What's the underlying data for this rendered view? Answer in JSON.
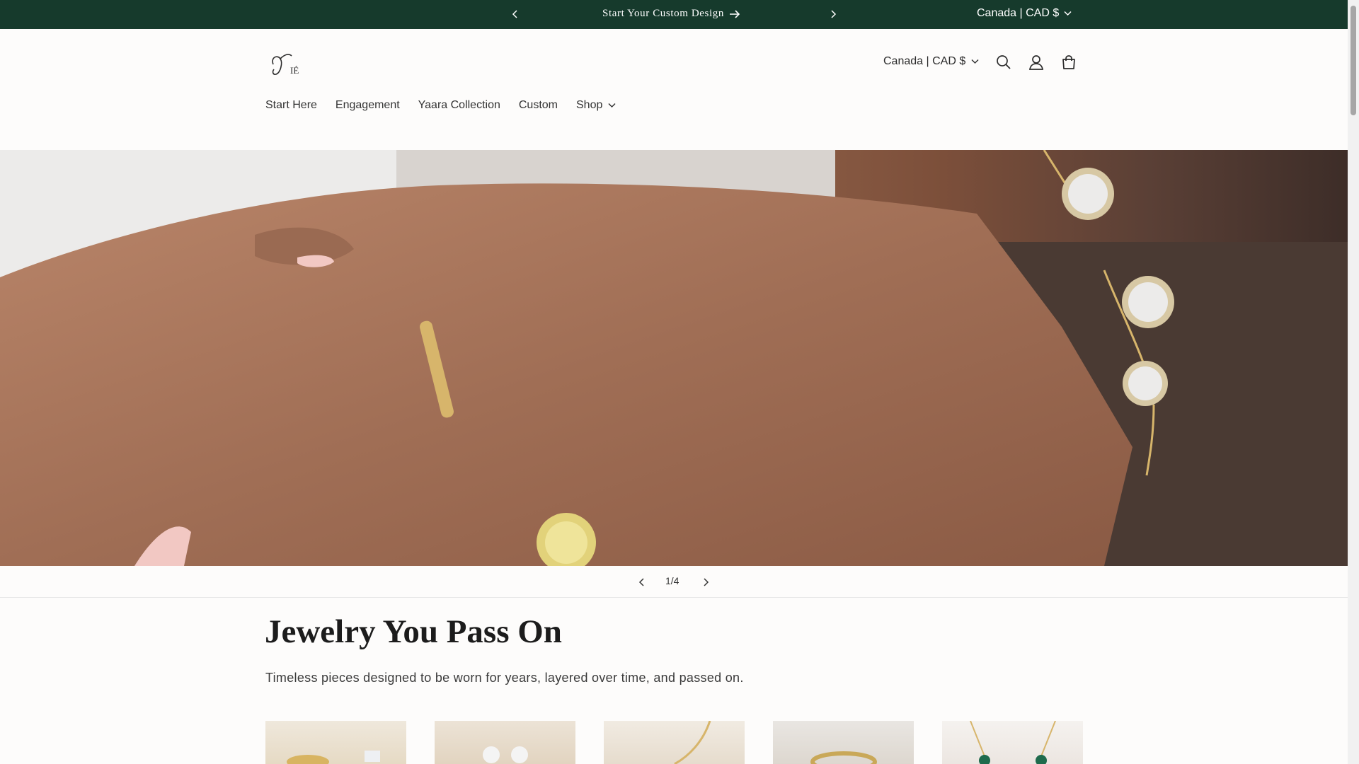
{
  "announcement": {
    "message": "Start Your Custom Design",
    "currency": "Canada | CAD $"
  },
  "header": {
    "logo_text": "VIÉ",
    "currency": "Canada | CAD $",
    "nav": [
      "Start Here",
      "Engagement",
      "Yaara Collection",
      "Custom",
      "Shop"
    ]
  },
  "slideshow": {
    "counter": "1/4"
  },
  "section": {
    "title": "Jewelry You Pass On",
    "subtitle": "Timeless pieces designed to be worn for years, layered over time, and passed on."
  },
  "colors": {
    "announcement_bg": "#163a2c",
    "page_bg": "#fdfcfb"
  },
  "icons": [
    "chevron-left-icon",
    "chevron-right-icon",
    "arrow-right-icon",
    "chevron-down-icon",
    "search-icon",
    "account-icon",
    "cart-icon"
  ]
}
